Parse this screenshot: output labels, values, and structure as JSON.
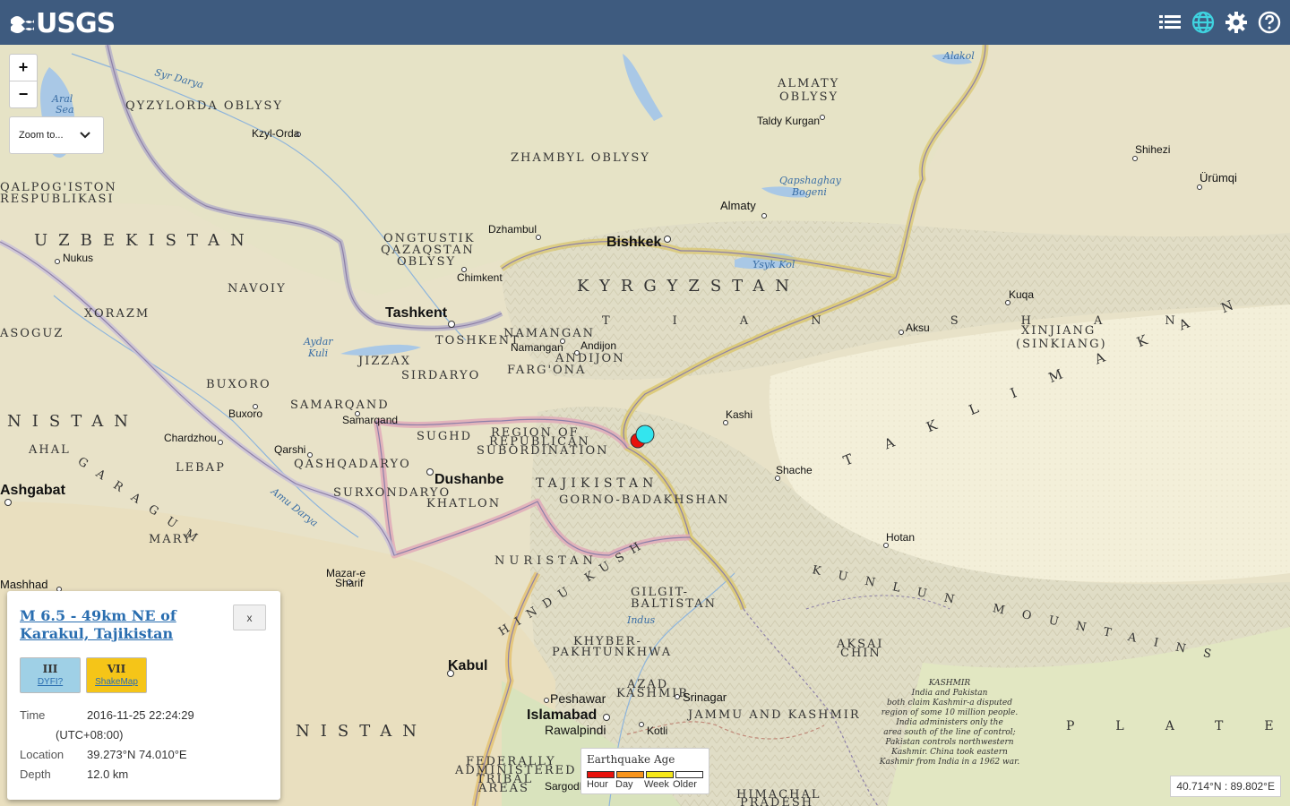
{
  "header": {
    "logo_text": "USGS",
    "icons": [
      "list-icon",
      "globe-icon",
      "gear-icon",
      "help-icon"
    ]
  },
  "map_controls": {
    "zoom_in": "+",
    "zoom_out": "−",
    "zoom_to": "Zoom to..."
  },
  "popup": {
    "title": "M 6.5 - 49km NE of Karakul, Tajikistan",
    "close": "x",
    "dyfi": {
      "value": "III",
      "label": "DYFI?",
      "color": "#9fd0e6"
    },
    "shakemap": {
      "value": "VII",
      "label": "ShakeMap",
      "color": "#f5c518"
    },
    "time_label": "Time",
    "time_value": "2016-11-25 22:24:29",
    "time_tz": "(UTC+08:00)",
    "location_label": "Location",
    "location_value": "39.273°N 74.010°E",
    "depth_label": "Depth",
    "depth_value": "12.0 km"
  },
  "legend": {
    "title": "Earthquake Age",
    "items": [
      {
        "label": "Hour",
        "color": "#e8120c"
      },
      {
        "label": "Day",
        "color": "#f7941d"
      },
      {
        "label": "Week",
        "color": "#f5e71a"
      },
      {
        "label": "Older",
        "color": "#ffffff"
      }
    ]
  },
  "cursor_coords": "40.714°N : 89.802°E",
  "earthquakes": [
    {
      "age": "Hour",
      "color": "#e8120c"
    },
    {
      "age": "Selected",
      "color": "#33e5ee"
    }
  ],
  "labels": {
    "countries": [
      "UZBEKISTAN",
      "KYRGYZSTAN",
      "TAJIKISTAN",
      "NISTAN",
      "NISTAN"
    ],
    "regions": [
      "QYZYLORDA OBLYSY",
      "ZHAMBYL OBLYSY",
      "ALMATY",
      "OBLYSY",
      "ONGTUSTIK",
      "QAZAQSTAN",
      "OBLYSY",
      "NAVOIY",
      "XORAZM",
      "QALPOG'ISTON",
      "RESPUBLIKASI",
      "ASOGUZ",
      "BUXORO",
      "SAMARQAND",
      "JIZZAX",
      "SIRDARYO",
      "TOSHKENT",
      "NAMANGAN",
      "ANDIJON",
      "FARG'ONA",
      "SUGHD",
      "REGION OF",
      "REPUBLICAN",
      "SUBORDINATION",
      "KHATLON",
      "GORNO-BADAKHSHAN",
      "QASHQADARYO",
      "SURXONDARYO",
      "AHAL",
      "LEBAP",
      "MARY",
      "GILGIT-",
      "BALTISTAN",
      "KHYBER-",
      "PAKHTUNKHWA",
      "AZAD",
      "KASHMIR",
      "JAMMU AND KASHMIR",
      "AKSAI",
      "CHIN",
      "FEDERALLY",
      "ADMINISTERED",
      "TRIBAL",
      "AREAS",
      "HIMACHAL",
      "PRADESH",
      "XINJIANG",
      "(SINKIANG)"
    ],
    "cities": [
      "Kzyl-Orda",
      "Nukus",
      "Dzhambul",
      "Chimkent",
      "Taldy Kurgan",
      "Almaty",
      "Shihezi",
      "Ürümqi",
      "Namangan",
      "Andijon",
      "Kuqa",
      "Aksu",
      "Buxoro",
      "Samarqand",
      "Chardzhou",
      "Qarshi",
      "Kashi",
      "Shache",
      "Hotan",
      "Mazar-e",
      "Sharif",
      "Mashhad",
      "Peshawar",
      "Rawalpindi",
      "Srinagar",
      "Kotli",
      "Sargodh",
      "Ashgabat"
    ],
    "capitals": [
      "Bishkek",
      "Tashkent",
      "Dushanbe",
      "Kabul",
      "Islamabad"
    ],
    "water": [
      "Syr Darya",
      "Aral",
      "Sea",
      "Alakol",
      "Qapshaghay",
      "Bogeni",
      "Ysyk Kol",
      "Aydar",
      "Kuli",
      "Amu Darya",
      "Indus"
    ],
    "ranges": [
      "TIAN SHAN",
      "HINDU KUSH",
      "NURISTAN",
      "KUNLUN MOUNTAINS",
      "TAKLIMAKAN DESERT",
      "GARAGUM",
      "PLATEAU"
    ],
    "kashmir_note": [
      "KASHMIR",
      "India and Pakistan",
      "both claim Kashmir-a disputed",
      "region of some 10 million people.",
      "India administers only the",
      "area south of the line of control;",
      "Pakistan controls northwestern",
      "Kashmir. China took eastern",
      "Kashmir from India in a 1962 war."
    ]
  }
}
